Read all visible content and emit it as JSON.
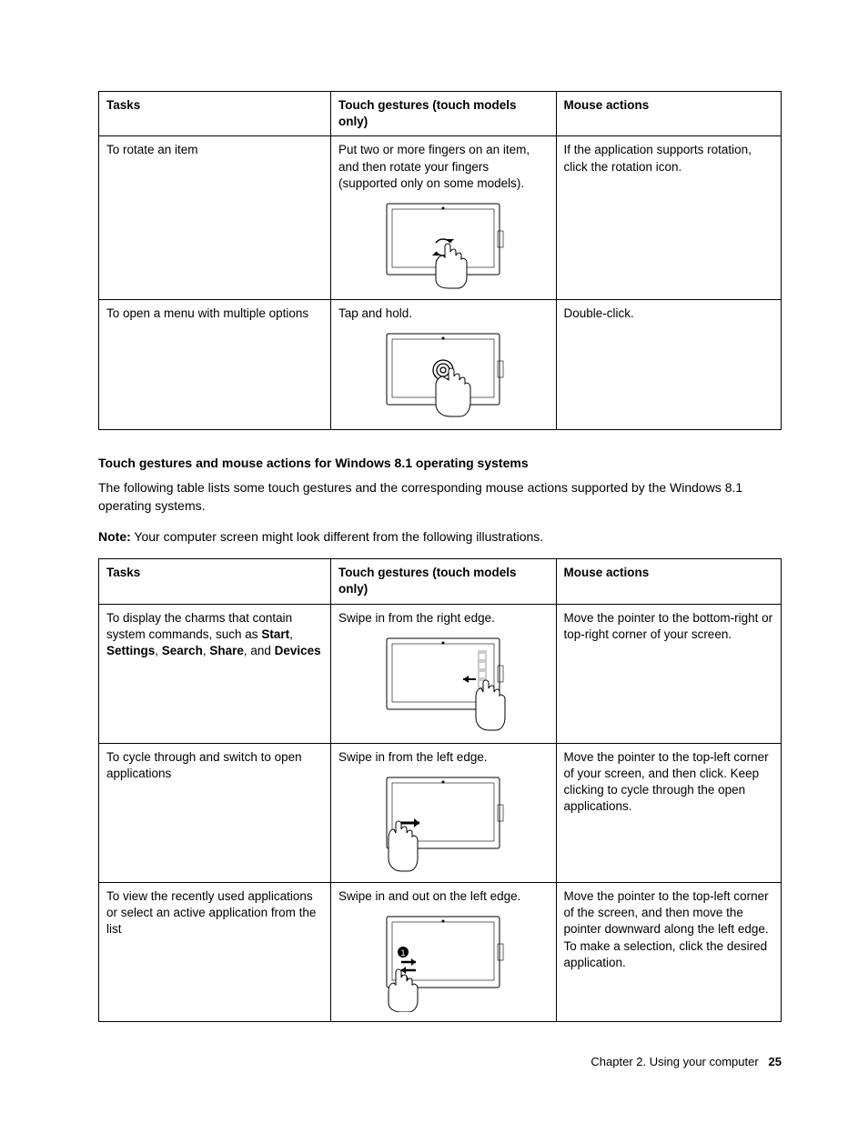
{
  "table1": {
    "headers": [
      "Tasks",
      "Touch gestures (touch models only)",
      "Mouse actions"
    ],
    "rows": [
      {
        "task": "To rotate an item",
        "gesture": "Put two or more fingers on an item, and then rotate your fingers (supported only on some models).",
        "mouse": "If the application supports rotation, click the rotation icon."
      },
      {
        "task": "To open a menu with multiple options",
        "gesture": "Tap and hold.",
        "mouse": "Double-click."
      }
    ]
  },
  "section_heading": "Touch gestures and mouse actions for Windows 8.1 operating systems",
  "intro_paragraph": "The following table lists some touch gestures and the corresponding mouse actions supported by the Windows 8.1 operating systems.",
  "note_label": "Note:",
  "note_text": " Your computer screen might look different from the following illustrations.",
  "table2": {
    "headers": [
      "Tasks",
      "Touch gestures (touch models only)",
      "Mouse actions"
    ],
    "rows": [
      {
        "task_pre": "To display the charms that contain system commands, such as ",
        "task_bold_parts": [
          "Start",
          "Settings",
          "Search",
          "Share",
          "Devices"
        ],
        "task_joiners": [
          ", ",
          ", ",
          ", ",
          ", and "
        ],
        "gesture": "Swipe in from the right edge.",
        "mouse": "Move the pointer to the bottom-right or top-right corner of your screen."
      },
      {
        "task": "To cycle through and switch to open applications",
        "gesture": "Swipe in from the left edge.",
        "mouse": "Move the pointer to the top-left corner of your screen, and then click. Keep clicking to cycle through the open applications."
      },
      {
        "task": "To view the recently used applications or select an active application from the list",
        "gesture": "Swipe in and out on the left edge.",
        "mouse": "Move the pointer to the top-left corner of the screen, and then move the pointer downward along the left edge. To make a selection, click the desired application."
      }
    ]
  },
  "footer_chapter": "Chapter 2. Using your computer",
  "footer_page": "25"
}
